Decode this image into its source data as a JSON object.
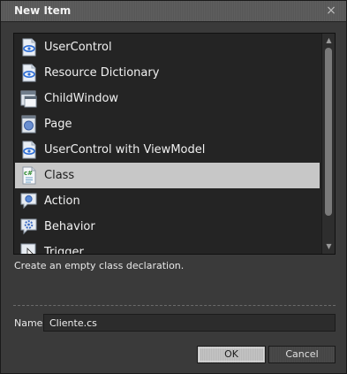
{
  "window": {
    "title": "New Item",
    "close_glyph": "×"
  },
  "items": [
    {
      "label": "UserControl",
      "icon": "usercontrol-icon",
      "selected": false
    },
    {
      "label": "Resource Dictionary",
      "icon": "resource-dictionary-icon",
      "selected": false
    },
    {
      "label": "ChildWindow",
      "icon": "childwindow-icon",
      "selected": false
    },
    {
      "label": "Page",
      "icon": "page-icon",
      "selected": false
    },
    {
      "label": "UserControl with ViewModel",
      "icon": "usercontrol-viewmodel-icon",
      "selected": false
    },
    {
      "label": "Class",
      "icon": "class-icon",
      "selected": true
    },
    {
      "label": "Action",
      "icon": "action-icon",
      "selected": false
    },
    {
      "label": "Behavior",
      "icon": "behavior-icon",
      "selected": false
    },
    {
      "label": "Trigger",
      "icon": "trigger-icon",
      "selected": false
    }
  ],
  "description": "Create an empty class declaration.",
  "name_field": {
    "label": "Name",
    "value": "Cliente.cs"
  },
  "buttons": {
    "ok": "OK",
    "cancel": "Cancel"
  },
  "scrollbar": {
    "up_glyph": "▲",
    "down_glyph": "▼"
  },
  "colors": {
    "selected_bg": "#c7c7c7",
    "list_bg": "#242424",
    "window_bg": "#3a3a3a"
  }
}
